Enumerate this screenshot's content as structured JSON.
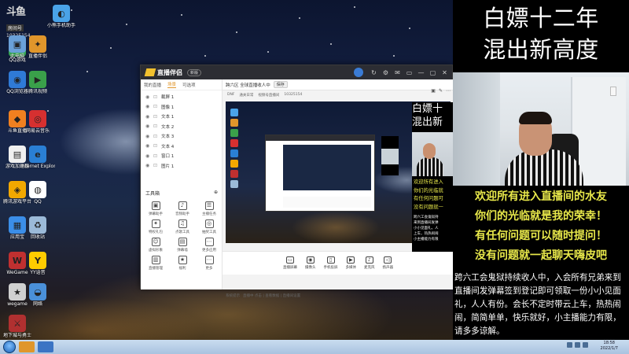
{
  "watermark": {
    "logo": "斗鱼",
    "label": "房间号",
    "room_id": "10325154"
  },
  "desktop_icons": [
    {
      "id": "d1",
      "label": "小熊手机助手",
      "color": "#4aa3e8",
      "glyph": "◐"
    },
    {
      "id": "d2",
      "label": "QQ游戏",
      "color": "#34a853",
      "glyph": "●"
    },
    {
      "id": "d3",
      "label": "此电脑",
      "color": "#6aa0d8",
      "glyph": "▣"
    },
    {
      "id": "d4",
      "label": "直播伴侣",
      "color": "#e0962b",
      "glyph": "✦"
    },
    {
      "id": "d5",
      "label": "QQ浏览器",
      "color": "#2f7ad6",
      "glyph": "◉"
    },
    {
      "id": "d6",
      "label": "腾讯视频",
      "color": "#3aa04a",
      "glyph": "▶"
    },
    {
      "id": "d7",
      "label": "斗鱼直播",
      "color": "#f08020",
      "glyph": "◆"
    },
    {
      "id": "d8",
      "label": "网易云音乐",
      "color": "#d63030",
      "glyph": "◎"
    },
    {
      "id": "d9",
      "label": "游戏加速器",
      "color": "#f0f0f0",
      "glyph": "▤"
    },
    {
      "id": "d10",
      "label": "Internet Explorer",
      "color": "#2a7fd4",
      "glyph": "e"
    },
    {
      "id": "d11",
      "label": "腾讯游戏平台",
      "color": "#f2a800",
      "glyph": "◈"
    },
    {
      "id": "d12",
      "label": "QQ",
      "color": "#ffffff",
      "glyph": "◍"
    },
    {
      "id": "d13",
      "label": "应用宝",
      "color": "#3b8ee8",
      "glyph": "▦"
    },
    {
      "id": "d14",
      "label": "回收站",
      "color": "#9bbad8",
      "glyph": "♻"
    },
    {
      "id": "d15",
      "label": "WeGame",
      "color": "#c03030",
      "glyph": "W"
    },
    {
      "id": "d16",
      "label": "YY语音",
      "color": "#ffcc00",
      "glyph": "Y"
    },
    {
      "id": "d17",
      "label": "wegame",
      "color": "#d0d0d0",
      "glyph": "★"
    },
    {
      "id": "d18",
      "label": "网络",
      "color": "#4a90d9",
      "glyph": "◒"
    },
    {
      "id": "d19",
      "label": "地下城与勇士",
      "color": "#b03030",
      "glyph": "⚔"
    }
  ],
  "app": {
    "name": "直播伴侣",
    "version": "新版",
    "title_icons": [
      "↻",
      "⚙",
      "✉",
      "▭",
      "—",
      "▢",
      "✕"
    ],
    "left_tabs": [
      "我的直播",
      "场景",
      "可选项"
    ],
    "active_tab_index": 1,
    "sources": [
      "截屏 1",
      "图像 1",
      "文本 1",
      "文本 2",
      "文本 3",
      "文本 4",
      "窗口 1",
      "图片 1"
    ],
    "tools_header": "工具箱",
    "tools": [
      "弹幕助手",
      "音频助手",
      "主播任务",
      "特权礼包",
      "点歌工具",
      "抽奖工具",
      "虚拟形象",
      "弹幕墙",
      "更多应用",
      "直播管理",
      "福利",
      "更多"
    ],
    "scene_title": "跨六区 全球直播收人中",
    "scene_button": "保存",
    "stats": [
      "DNF",
      "通关日常",
      "视频号直播间",
      "10325154"
    ],
    "bottom_tools": [
      "直播屏幕",
      "摄像头",
      "手机投屏",
      "多媒体",
      "麦克风",
      "扬声器"
    ],
    "right_controls": [
      "▣",
      "✎",
      "⋯"
    ],
    "footer": [
      "系统提示",
      "直播中 点击 | 查看数据 | 直播间设置"
    ]
  },
  "overlay": {
    "title_1": "白嫖十二年",
    "title_2": "混出新高度",
    "yellow_lines": [
      "欢迎所有进入直播间的水友",
      "你们的光临就是我的荣幸！",
      "有任何问题可以随时提问！",
      "没有问题就一起聊天嗨皮吧"
    ],
    "scroll_text": "跨六工会鬼狱持续收人中，入会所有兄弟来到直播间发弹幕签到登记即可领取一份小小见面礼，人人有份。会长不定时带云上车，热热闹闹，简简单单，快乐就好，小主播能力有限，请多多谅解。"
  },
  "mini_overlay": {
    "title_1": "白嫖十",
    "title_2": "混出新",
    "yellow_lines": [
      "欢迎所有进入",
      "你们的光临就",
      "有任何问题可",
      "没有问题就一"
    ],
    "scroll_lines": [
      "跨六工会鬼狱持",
      "来到直播间发弹",
      "小小见面礼，人",
      "上车，热热闹闹",
      "小主播能力有限"
    ]
  },
  "taskbar": {
    "time": "18:58",
    "date": "2022/1/7"
  }
}
